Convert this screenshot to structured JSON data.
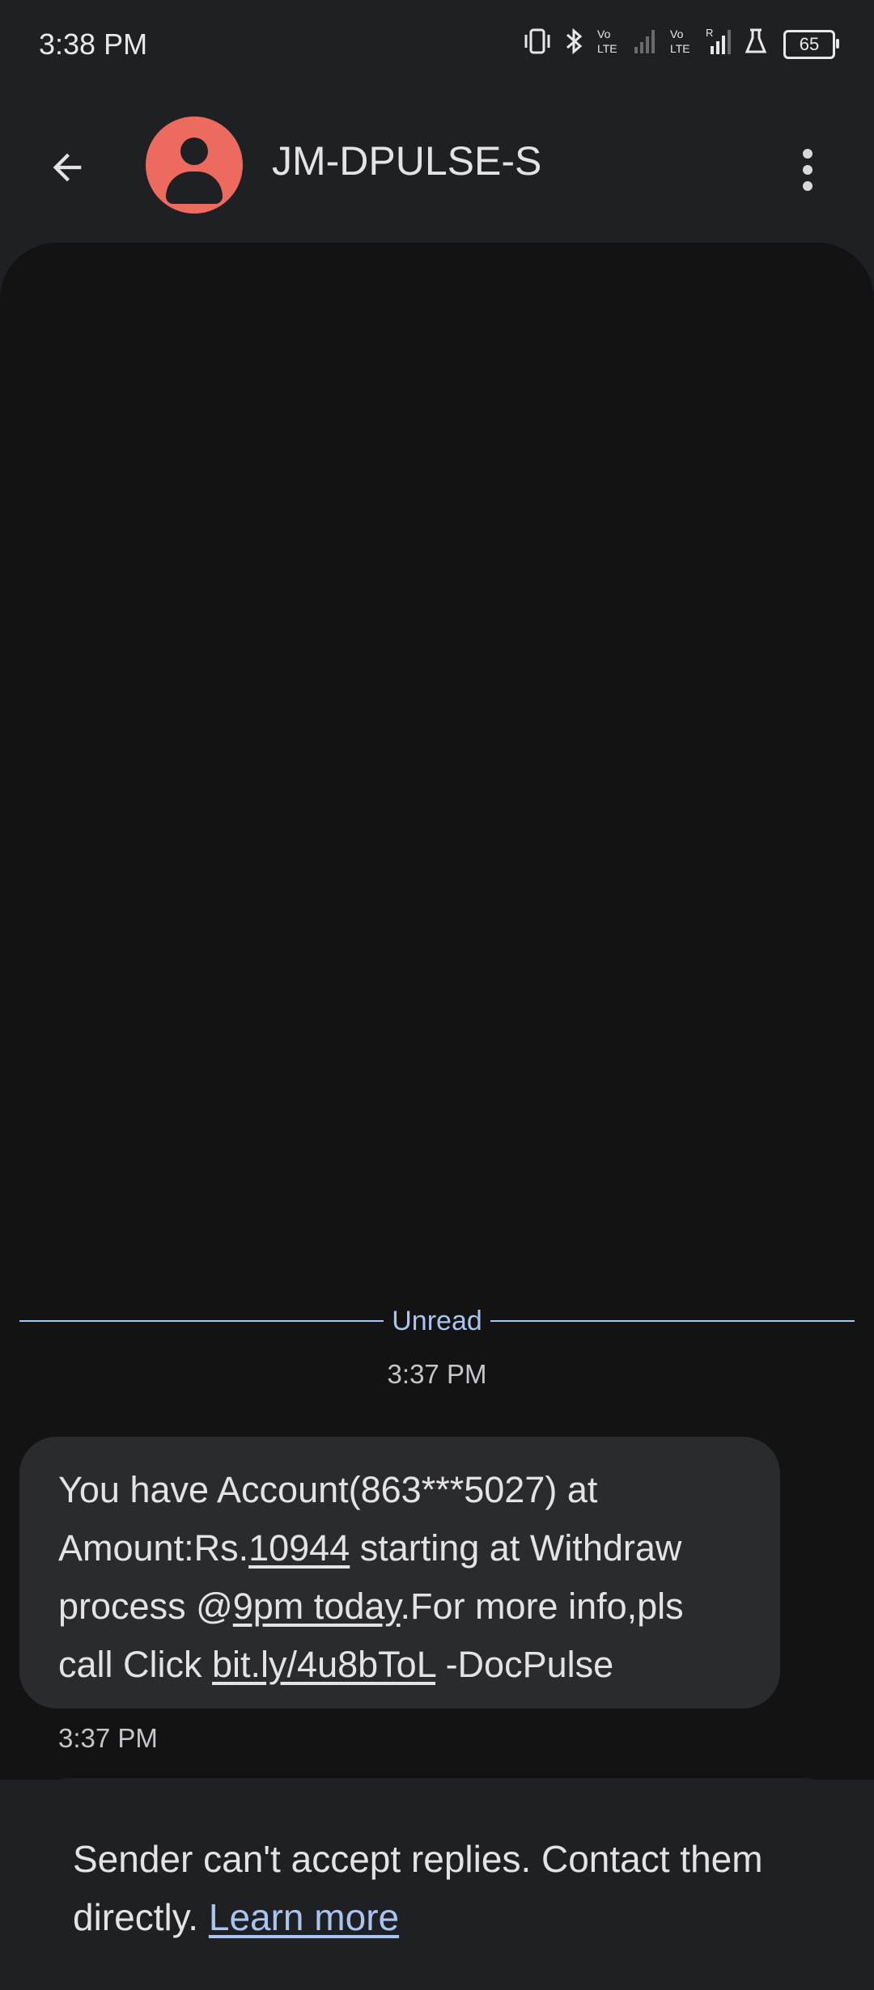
{
  "status_bar": {
    "time": "3:38 PM",
    "battery": "65",
    "icons": [
      "vibrate-icon",
      "bluetooth-icon",
      "volte-icon",
      "signal-icon",
      "volte-icon",
      "signal-roaming-icon",
      "lab-icon",
      "battery-icon"
    ],
    "volte_label": "Vo\nLTE",
    "roaming_label": "R"
  },
  "header": {
    "contact_name": "JM-DPULSE-S",
    "avatar_color": "#ec6b5e"
  },
  "conversation": {
    "unread_label": "Unread",
    "date_header_time": "3:37 PM",
    "message": {
      "part1": "You have Account(863***5027) at Amount:Rs.",
      "amount_link": "10944",
      "part2": " starting at Withdraw process @",
      "time_link": "9pm today",
      "part3": ".For more info,pls call Click ",
      "url_link": "bit.ly/4u8bToL",
      "part4": " -DocPulse",
      "time": "3:37 PM"
    }
  },
  "reply_notice": {
    "text": "Sender can't accept replies. Contact them directly. ",
    "link": "Learn more"
  },
  "colors": {
    "background": "#1f2023",
    "conversation_bg": "#131314",
    "bubble": "#2a2b2e",
    "accent": "#a8c4f0"
  }
}
